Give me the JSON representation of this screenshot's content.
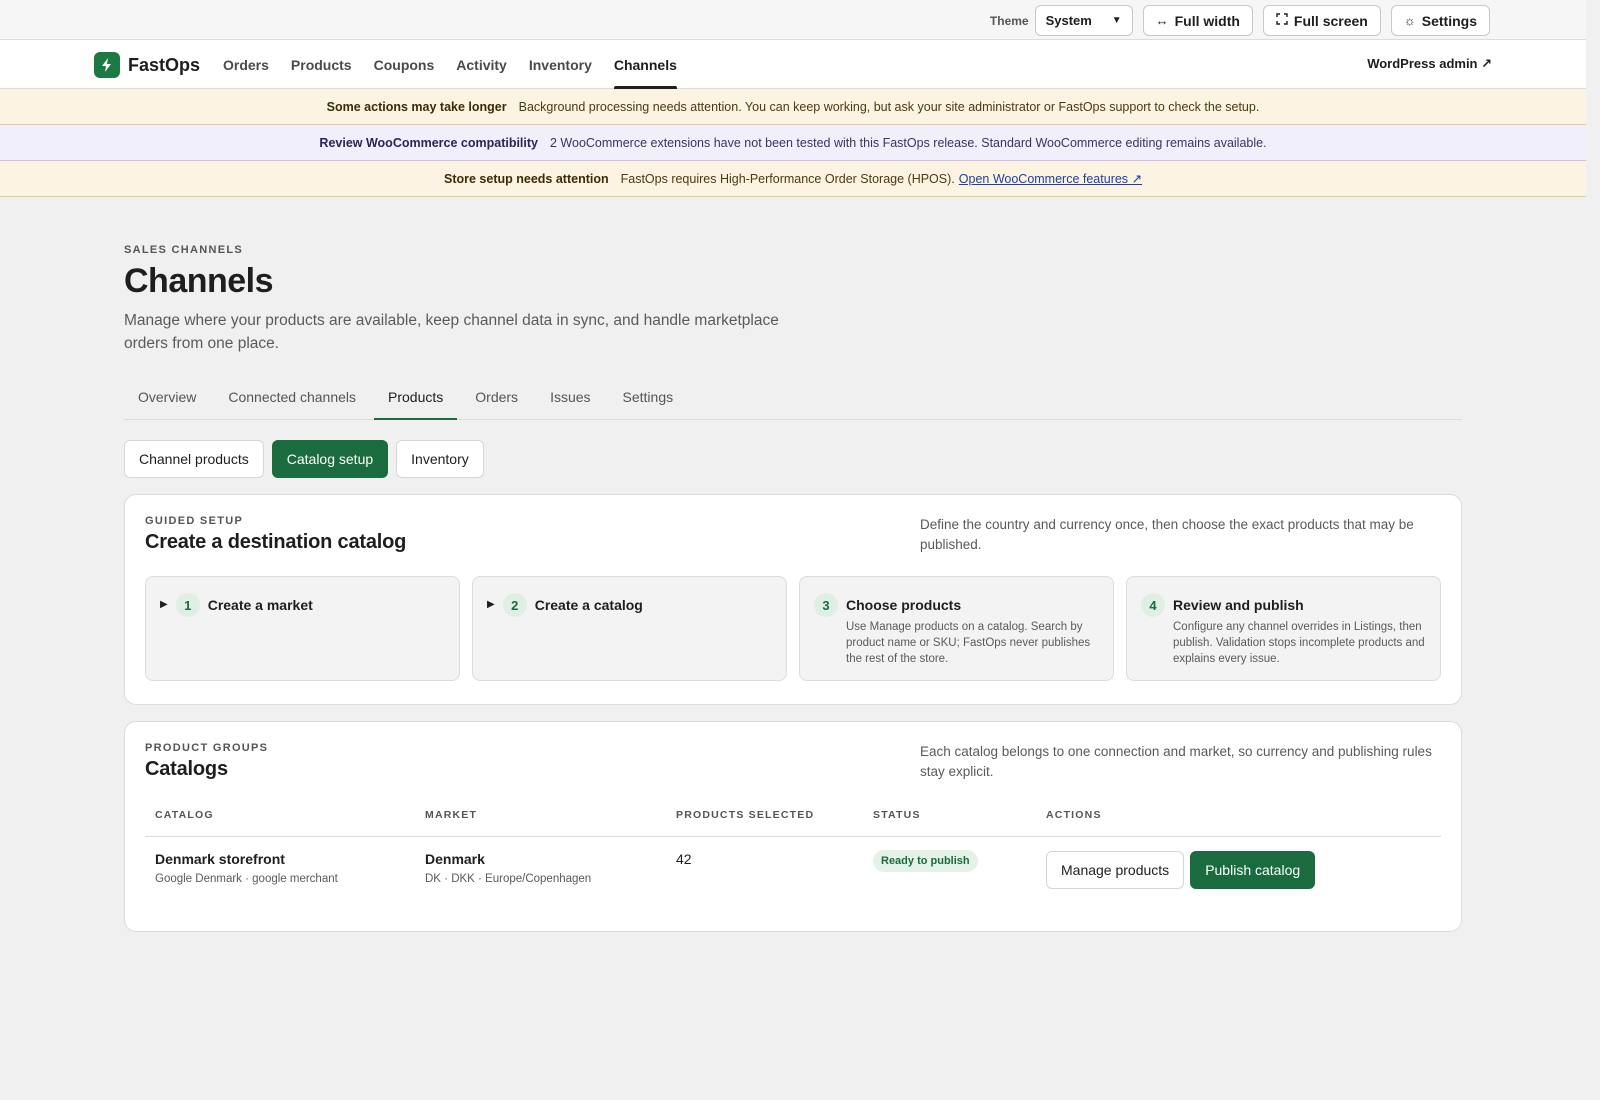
{
  "utility_bar": {
    "theme_label": "Theme",
    "theme_value": "System",
    "full_width_label": "Full width",
    "full_screen_label": "Full screen",
    "settings_label": "Settings"
  },
  "nav": {
    "brand": "FastOps",
    "links": [
      "Orders",
      "Products",
      "Coupons",
      "Activity",
      "Inventory",
      "Channels"
    ],
    "active": "Channels",
    "wp_admin": "WordPress admin ↗"
  },
  "notices": [
    {
      "title": "Some actions may take longer",
      "text": "Background processing needs attention. You can keep working, but ask your site administrator or FastOps support to check the setup.",
      "tone": "warn"
    },
    {
      "title": "Review WooCommerce compatibility",
      "text": "2 WooCommerce extensions have not been tested with this FastOps release. Standard WooCommerce editing remains available.",
      "tone": "info"
    },
    {
      "title": "Store setup needs attention",
      "text": "FastOps requires High-Performance Order Storage (HPOS).",
      "link": "Open WooCommerce features ↗",
      "tone": "warn"
    }
  ],
  "page": {
    "eyebrow": "SALES CHANNELS",
    "title": "Channels",
    "description": "Manage where your products are available, keep channel data in sync, and handle marketplace orders from one place."
  },
  "tabs": [
    "Overview",
    "Connected channels",
    "Products",
    "Orders",
    "Issues",
    "Settings"
  ],
  "active_tab": "Products",
  "subtabs": [
    "Channel products",
    "Catalog setup",
    "Inventory"
  ],
  "active_subtab": "Catalog setup",
  "guided_setup": {
    "eyebrow": "GUIDED SETUP",
    "title": "Create a destination catalog",
    "aside": "Define the country and currency once, then choose the exact products that may be published.",
    "steps": [
      {
        "num": "1",
        "title": "Create a market",
        "desc": "",
        "collapsible": true
      },
      {
        "num": "2",
        "title": "Create a catalog",
        "desc": "",
        "collapsible": true
      },
      {
        "num": "3",
        "title": "Choose products",
        "desc": "Use Manage products on a catalog. Search by product name or SKU; FastOps never publishes the rest of the store.",
        "collapsible": false
      },
      {
        "num": "4",
        "title": "Review and publish",
        "desc": "Configure any channel overrides in Listings, then publish. Validation stops incomplete products and explains every issue.",
        "collapsible": false
      }
    ]
  },
  "catalogs": {
    "eyebrow": "PRODUCT GROUPS",
    "title": "Catalogs",
    "aside": "Each catalog belongs to one connection and market, so currency and publishing rules stay explicit.",
    "columns": [
      "CATALOG",
      "MARKET",
      "PRODUCTS SELECTED",
      "STATUS",
      "ACTIONS"
    ],
    "rows": [
      {
        "catalog": "Denmark storefront",
        "catalog_sub": "Google Denmark · google merchant",
        "market": "Denmark",
        "market_sub": "DK · DKK · Europe/Copenhagen",
        "products_selected": "42",
        "status": "Ready to publish",
        "action_secondary": "Manage products",
        "action_primary": "Publish catalog"
      }
    ]
  },
  "colors": {
    "accent": "#1a6b3d",
    "brand": "#1a7a42",
    "warn_bg": "#fdf3e3",
    "info_bg": "#f1effc"
  }
}
